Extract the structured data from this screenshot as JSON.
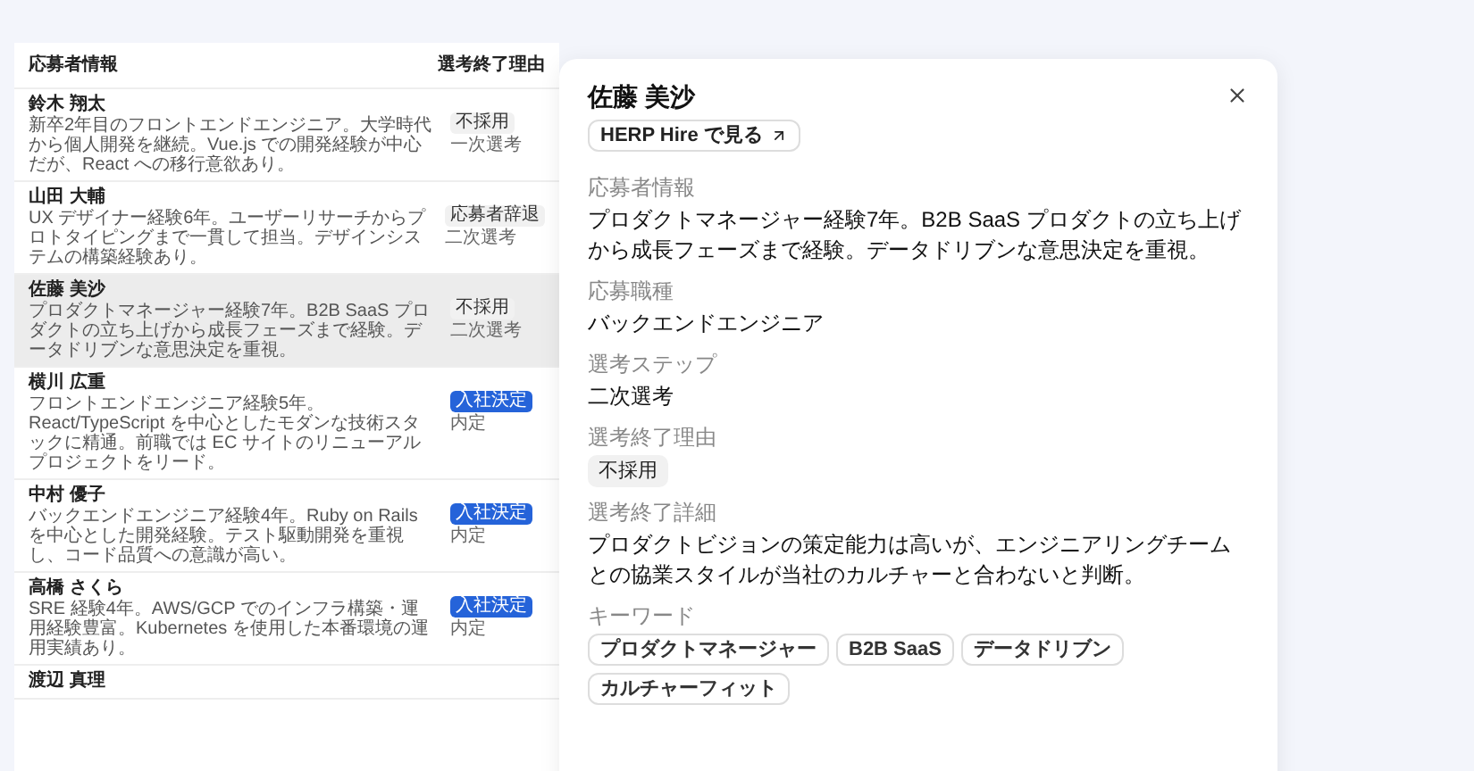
{
  "table": {
    "columns": [
      "応募者情報",
      "選考終了理由"
    ],
    "rows": [
      {
        "name": "鈴木 翔太",
        "description": "新卒2年目のフロントエンドエンジニア。大学時代から個人開発を継続。Vue.js での開発経験が中心だが、React への移行意欲あり。",
        "reason": {
          "label": "不採用",
          "kind": "neutral"
        },
        "step": "一次選考",
        "selected": false
      },
      {
        "name": "山田 大輔",
        "description": "UX デザイナー経験6年。ユーザーリサーチからプロトタイピングまで一貫して担当。デザインシステムの構築経験あり。",
        "reason": {
          "label": "応募者辞退",
          "kind": "neutral"
        },
        "step": "二次選考",
        "selected": false
      },
      {
        "name": "佐藤 美沙",
        "description": "プロダクトマネージャー経験7年。B2B SaaS プロダクトの立ち上げから成長フェーズまで経験。データドリブンな意思決定を重視。",
        "reason": {
          "label": "不採用",
          "kind": "neutral"
        },
        "step": "二次選考",
        "selected": true
      },
      {
        "name": "横川 広重",
        "description": "フロントエンドエンジニア経験5年。React/TypeScript を中心としたモダンな技術スタックに精通。前職では EC サイトのリニューアルプロジェクトをリード。",
        "reason": {
          "label": "入社決定",
          "kind": "primary"
        },
        "step": "内定",
        "selected": false
      },
      {
        "name": "中村 優子",
        "description": "バックエンドエンジニア経験4年。Ruby on Rails を中心とした開発経験。テスト駆動開発を重視し、コード品質への意識が高い。",
        "reason": {
          "label": "入社決定",
          "kind": "primary"
        },
        "step": "内定",
        "selected": false
      },
      {
        "name": "高橋 さくら",
        "description": "SRE 経験4年。AWS/GCP でのインフラ構築・運用経験豊富。Kubernetes を使用した本番環境の運用実績あり。",
        "reason": {
          "label": "入社決定",
          "kind": "primary"
        },
        "step": "内定",
        "selected": false
      },
      {
        "name": "渡辺 真理",
        "selected": false
      }
    ]
  },
  "detail": {
    "name": "佐藤 美沙",
    "link": "HERP Hire で見る",
    "fields": [
      {
        "label": "応募者情報",
        "value": "プロダクトマネージャー経験7年。B2B SaaS プロダクトの立ち上げから成長フェーズまで経験。データドリブンな意思決定を重視。",
        "kind": "text"
      },
      {
        "label": "応募職種",
        "value": "バックエンドエンジニア",
        "kind": "text"
      },
      {
        "label": "選考ステップ",
        "value": "二次選考",
        "kind": "text"
      },
      {
        "label": "選考終了理由",
        "value": "不採用",
        "kind": "tag"
      },
      {
        "label": "選考終了詳細",
        "value": "プロダクトビジョンの策定能力は高いが、エンジニアリングチームとの協業スタイルが当社のカルチャーと合わないと判断。",
        "kind": "text"
      },
      {
        "label": "キーワード",
        "values": [
          "プロダクトマネージャー",
          "B2B SaaS",
          "データドリブン",
          "カルチャーフィット"
        ],
        "kind": "chips"
      }
    ]
  }
}
